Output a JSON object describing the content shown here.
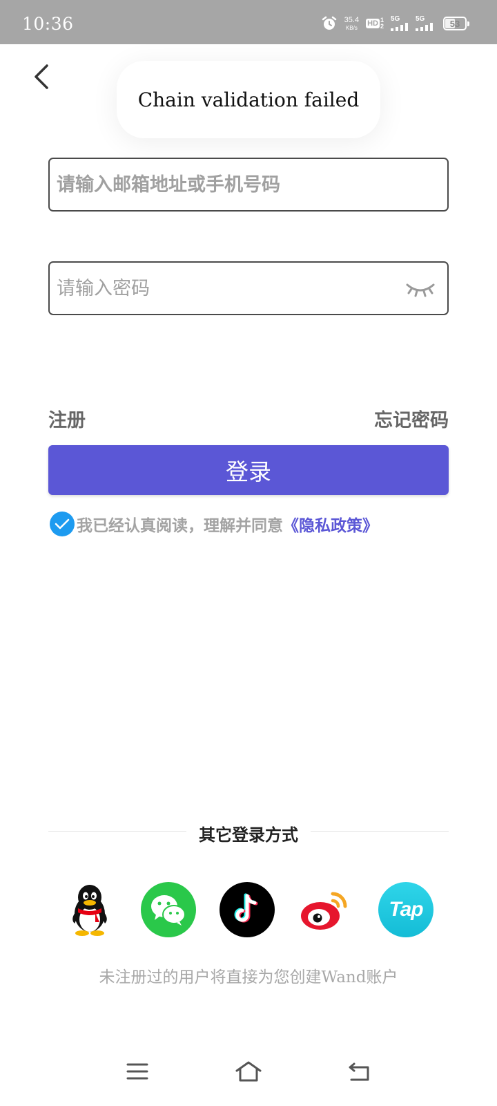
{
  "status_bar": {
    "time": "10:36",
    "net_speed_value": "35.4",
    "net_speed_unit": "KB/s",
    "hd_label": "HD",
    "hd_sub_top": "1",
    "hd_sub_bottom": "2",
    "sim1_label": "5G",
    "sim2_label": "5G",
    "battery": "53",
    "battery_level": 0.53
  },
  "toast": {
    "message": "Chain validation failed"
  },
  "form": {
    "email_placeholder": "请输入邮箱地址或手机号码",
    "password_placeholder": "请输入密码"
  },
  "links": {
    "register": "注册",
    "forgot_password": "忘记密码"
  },
  "login_button": "登录",
  "agreement": {
    "text": "我已经认真阅读，理解并同意",
    "policy": "《隐私政策》",
    "checked": true
  },
  "other_login": {
    "title": "其它登录方式",
    "providers": [
      "qq-icon",
      "wechat-icon",
      "tiktok-icon",
      "weibo-icon",
      "taptap-icon"
    ],
    "tap_label": "Tap"
  },
  "notice": "未注册过的用户将直接为您创建Wand账户",
  "colors": {
    "primary": "#5b57d6",
    "check": "#1d9bf0",
    "status_bar": "#a6a6a6"
  }
}
